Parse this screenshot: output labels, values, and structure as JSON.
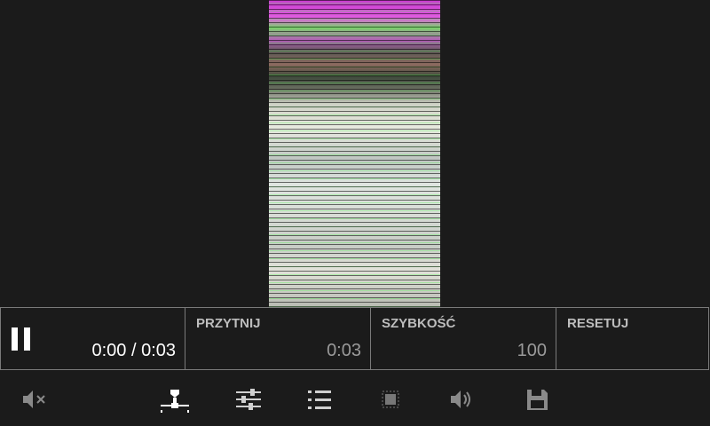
{
  "player": {
    "time_readout": "0:00 / 0:03"
  },
  "trim": {
    "label": "PRZYTNIJ",
    "value": "0:03"
  },
  "speed": {
    "label": "SZYBKOŚĆ",
    "value": "100"
  },
  "reset": {
    "label": "RESETUJ"
  },
  "toolbar": {
    "icons": [
      "mute-icon",
      "trim-marker-icon",
      "adjust-sliders-icon",
      "list-icon",
      "crop-icon",
      "volume-icon",
      "save-icon"
    ]
  },
  "colors": {
    "background": "#1b1b1b",
    "border": "#7a7a7a",
    "label": "#bdbdbd",
    "value": "#9a9a9a"
  }
}
